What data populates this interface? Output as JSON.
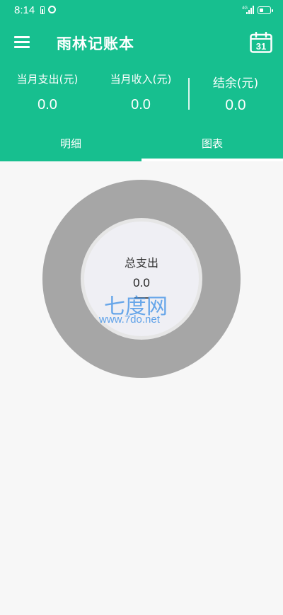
{
  "status_bar": {
    "time": "8:14",
    "network": "4G"
  },
  "app": {
    "title": "雨林记账本",
    "calendar_day": "31"
  },
  "summary": {
    "expense_label": "当月支出(元)",
    "expense_value": "0.0",
    "income_label": "当月收入(元)",
    "income_value": "0.0",
    "balance_label": "结余(元)",
    "balance_value": "0.0"
  },
  "tabs": [
    {
      "label": "明细",
      "active": false
    },
    {
      "label": "图表",
      "active": true
    }
  ],
  "chart": {
    "center_label": "总支出",
    "center_value": "0.0",
    "center_dash": "—"
  },
  "chart_data": {
    "type": "pie",
    "categories": [],
    "values": [],
    "center_label": "总支出",
    "center_value": 0.0
  },
  "watermark": {
    "text": "七度网",
    "url": "www.7do.net"
  },
  "colors": {
    "primary": "#17bf8f",
    "ring": "#a6a6a6",
    "inner": "#efeff4",
    "background": "#f7f7f7"
  }
}
